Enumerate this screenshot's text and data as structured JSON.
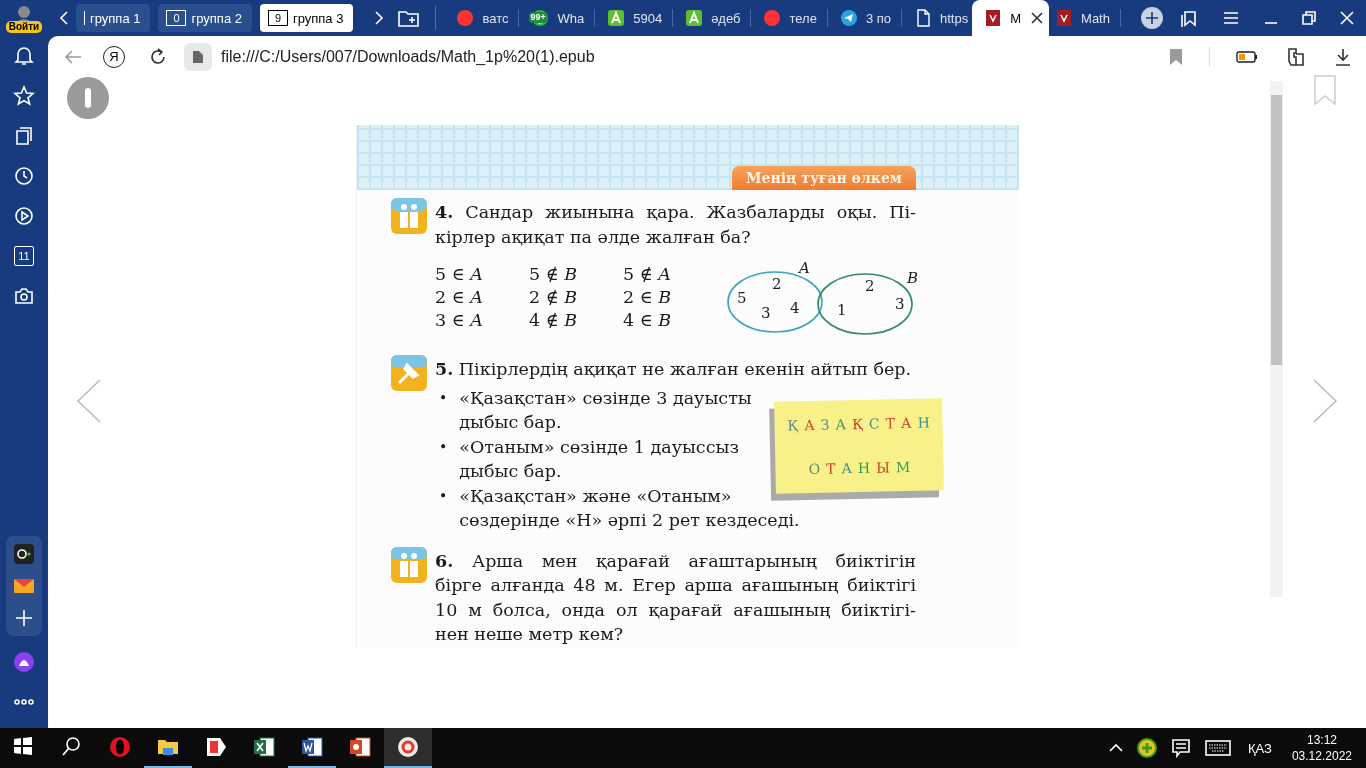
{
  "profile": {
    "label": "Войти"
  },
  "tab_groups": [
    {
      "label": "группа 1",
      "selected": false
    },
    {
      "count": "0",
      "label": "группа 2",
      "selected": false
    },
    {
      "count": "9",
      "label": "группа 3",
      "selected": true
    }
  ],
  "tabs": [
    {
      "kind": "yandex",
      "title": "ватс",
      "selected": false
    },
    {
      "kind": "whatsapp",
      "badge": "99+",
      "title": "Wha",
      "selected": false
    },
    {
      "kind": "letter-a",
      "title": "5904",
      "selected": false
    },
    {
      "kind": "letter-a",
      "title": "әдеб",
      "selected": false
    },
    {
      "kind": "yandex",
      "title": "теле",
      "selected": false
    },
    {
      "kind": "telegram",
      "title": "3 по",
      "selected": false
    },
    {
      "kind": "page",
      "title": "https",
      "selected": false
    },
    {
      "kind": "book",
      "title": "M",
      "selected": true
    },
    {
      "kind": "book",
      "title": "Math",
      "selected": false
    }
  ],
  "address_bar": {
    "home": "Я",
    "url": "file:///C:/Users/007/Downloads/Math_1p%20(1).epub"
  },
  "sidebar": {
    "items": [
      {
        "kind": "bell"
      },
      {
        "kind": "star"
      },
      {
        "kind": "collections"
      },
      {
        "kind": "clock"
      },
      {
        "kind": "play"
      },
      {
        "kind": "calendar",
        "label": "11"
      },
      {
        "kind": "camera"
      }
    ],
    "bottom": [
      {
        "kind": "recorder"
      },
      {
        "kind": "mail"
      },
      {
        "kind": "add"
      },
      {
        "kind": "assistant"
      },
      {
        "kind": "more"
      }
    ]
  },
  "book": {
    "badge": "Менің туған өлкем",
    "tasks": [
      {
        "kind": "pair",
        "lines": [
          "**4.** Сандар жиынына қара. Жазбаларды оқы. Пі-",
          "кірлер ақиқат па әлде жалған ба?"
        ],
        "relations": [
          [
            "5 ∈ *A*",
            "5 ∉ *B*",
            "5 ∉ *A*"
          ],
          [
            "2 ∈ *A*",
            "2 ∉ *B*",
            "2 ∈ *B*"
          ],
          [
            "3 ∈ *A*",
            "4 ∉ *B*",
            "4 ∈ *B*"
          ]
        ],
        "venn": [
          {
            "label": "A",
            "color": "#3aa6c0",
            "items": [
              "5",
              "2",
              "3",
              "4"
            ]
          },
          {
            "label": "B",
            "color": "#2f8a66",
            "items": [
              "1",
              "2",
              "3"
            ]
          }
        ]
      },
      {
        "kind": "pin",
        "lines": [
          "**5.** Пікірлердің ақиқат не жалған екенін айтып бер."
        ],
        "marker": "•",
        "bullets": [
          [
            "«Қазақстан» сөзінде 3 дауысты",
            "дыбыс бар."
          ],
          [
            "«Отаным» сөзінде 1 дауыссыз",
            "дыбыс бар."
          ],
          [
            "«Қазақстан» және «Отаным»",
            "сөздерінде «Н» әрпі 2 рет кездеседі."
          ]
        ],
        "note": [
          [
            {
              "char": "Қ",
              "color": "#5b8a8a"
            },
            {
              "char": "А",
              "color": "#d2452f"
            },
            {
              "char": "З",
              "color": "#4e8c8c"
            },
            {
              "char": "А",
              "color": "#3f9a4a"
            },
            {
              "char": "Қ",
              "color": "#c8402c"
            },
            {
              "char": "С",
              "color": "#3d8f9a"
            },
            {
              "char": "Т",
              "color": "#d2452f"
            },
            {
              "char": "А",
              "color": "#c8402c"
            },
            {
              "char": "Н",
              "color": "#3d8f9a"
            }
          ],
          [
            {
              "char": "О",
              "color": "#6c8a6a"
            },
            {
              "char": "Т",
              "color": "#c8402c"
            },
            {
              "char": "А",
              "color": "#3d8f9a"
            },
            {
              "char": "Н",
              "color": "#3f9a4a"
            },
            {
              "char": "Ы",
              "color": "#c8402c"
            },
            {
              "char": "М",
              "color": "#3f9a4a"
            }
          ]
        ]
      },
      {
        "kind": "pair",
        "lines": [
          "**6.** Арша мен қарағай ағаштарының биіктігін",
          "бірге алғанда 48 м. Егер арша ағашының биіктігі",
          "10 м болса, онда ол қарағай ағашының биіктігі-",
          "нен неше метр кем?"
        ]
      }
    ]
  },
  "taskbar": {
    "apps": [
      {
        "kind": "start"
      },
      {
        "kind": "search"
      },
      {
        "kind": "opera",
        "running": false,
        "selected": false
      },
      {
        "kind": "explorer",
        "running": true,
        "selected": false
      },
      {
        "kind": "yandex-app",
        "running": false,
        "selected": false
      },
      {
        "kind": "excel",
        "running": false,
        "selected": false
      },
      {
        "kind": "word",
        "running": true,
        "selected": false
      },
      {
        "kind": "powerpoint",
        "running": false,
        "selected": false
      },
      {
        "kind": "yandex-browser",
        "running": true,
        "selected": true
      }
    ],
    "tray": {
      "language": "ҚАЗ",
      "time": "13:12",
      "date": "03.12.2022"
    }
  }
}
